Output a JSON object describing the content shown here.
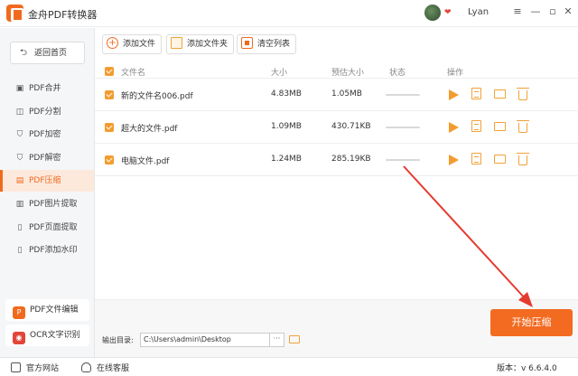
{
  "window": {
    "title": "金舟PDF转换器",
    "username": "Lyan",
    "minimize": "—",
    "restore": "▫",
    "close": "✕",
    "menu": "≡"
  },
  "sidebar": {
    "back_label": "返回首页",
    "back_arrow": "⮌",
    "items": [
      {
        "label": "PDF合并",
        "icon": "merge-icon",
        "glyph": "▣"
      },
      {
        "label": "PDF分割",
        "icon": "split-icon",
        "glyph": "◫"
      },
      {
        "label": "PDF加密",
        "icon": "lock-icon",
        "glyph": "⛉"
      },
      {
        "label": "PDF解密",
        "icon": "unlock-icon",
        "glyph": "⛉"
      },
      {
        "label": "PDF压缩",
        "icon": "compress-icon",
        "glyph": "▤",
        "active": true
      },
      {
        "label": "PDF图片提取",
        "icon": "image-icon",
        "glyph": "▥"
      },
      {
        "label": "PDF页面提取",
        "icon": "page-icon",
        "glyph": "▯"
      },
      {
        "label": "PDF添加水印",
        "icon": "watermark-icon",
        "glyph": "▯"
      }
    ],
    "promos": [
      {
        "label": "PDF文件编辑",
        "glyph": "P",
        "color": "#f06a1e"
      },
      {
        "label": "OCR文字识别",
        "glyph": "◉",
        "color": "#e2463a"
      }
    ]
  },
  "toolbar": {
    "add_file": "添加文件",
    "add_folder": "添加文件夹",
    "clear_list": "清空列表"
  },
  "table": {
    "headers": {
      "name": "文件名",
      "size": "大小",
      "estimate": "预估大小",
      "status": "状态",
      "actions": "操作"
    },
    "rows": [
      {
        "name": "新的文件名006.pdf",
        "size": "4.83MB",
        "estimate": "1.05MB",
        "checked": true
      },
      {
        "name": "超大的文件.pdf",
        "size": "1.09MB",
        "estimate": "430.71KB",
        "checked": true
      },
      {
        "name": "电脑文件.pdf",
        "size": "1.24MB",
        "estimate": "285.19KB",
        "checked": true
      }
    ]
  },
  "output": {
    "label": "输出目录:",
    "path": "C:\\Users\\admin\\Desktop",
    "browse": "···"
  },
  "start_button": "开始压缩",
  "statusbar": {
    "website": "官方网站",
    "support": "在线客服",
    "version": "版本：v 6.6.4.0"
  },
  "colors": {
    "accent": "#f26b21",
    "annotation_arrow": "#e53a2f"
  }
}
